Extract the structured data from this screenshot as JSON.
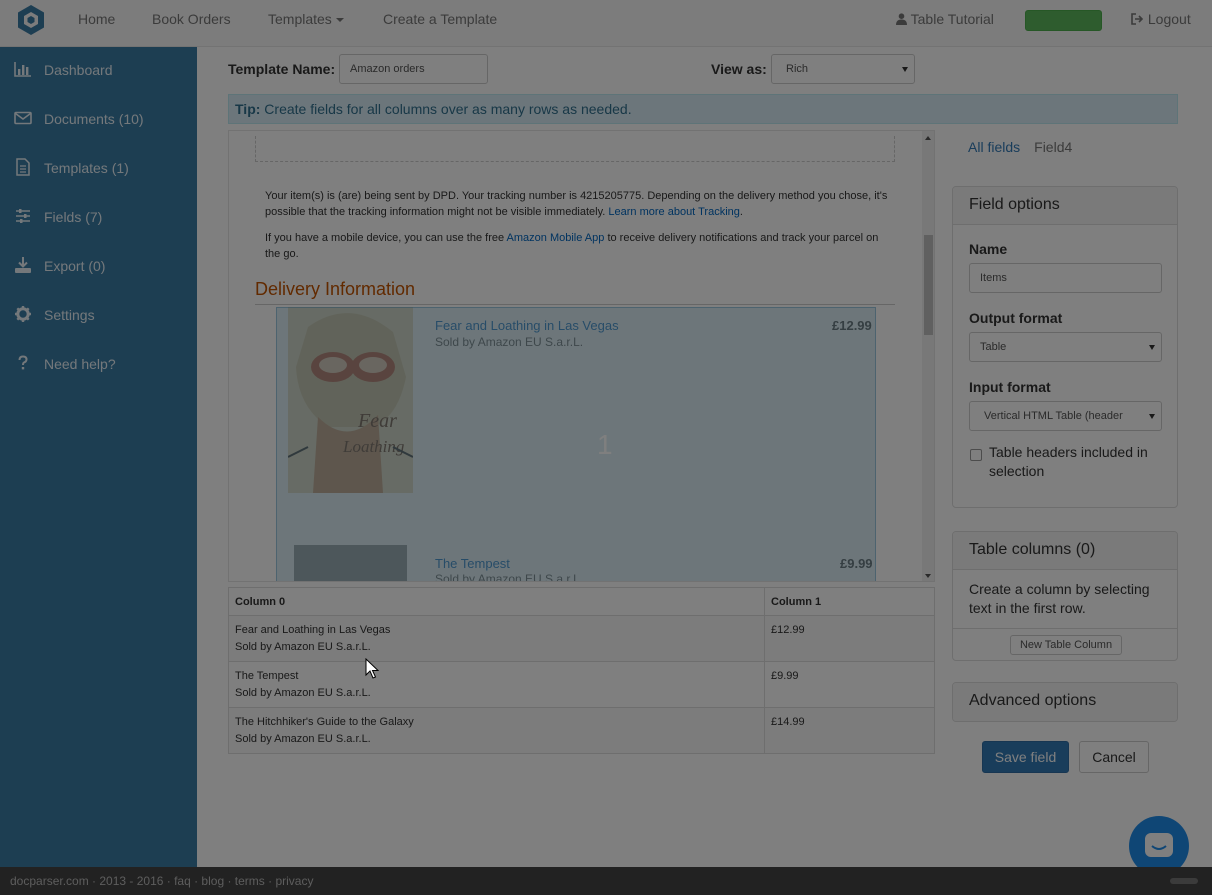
{
  "nav": {
    "links": [
      "Home",
      "Book Orders",
      "Templates",
      "Create a Template"
    ],
    "user": "Table Tutorial",
    "logout": "Logout",
    "badge_color": "#5cb85c"
  },
  "sidebar": {
    "bg_color": "#3a7ca5",
    "items": [
      {
        "label": "Dashboard",
        "icon": "bar-chart-icon"
      },
      {
        "label": "Documents (10)",
        "icon": "envelope-icon"
      },
      {
        "label": "Templates (1)",
        "icon": "file-icon"
      },
      {
        "label": "Fields (7)",
        "icon": "sliders-icon"
      },
      {
        "label": "Export (0)",
        "icon": "download-icon"
      },
      {
        "label": "Settings",
        "icon": "gear-icon"
      },
      {
        "label": "Need help?",
        "icon": "question-icon"
      }
    ]
  },
  "template": {
    "name_label": "Template Name:",
    "name_value": "Amazon orders",
    "viewas_label": "View as:",
    "viewas_value": "Rich"
  },
  "tip": {
    "prefix": "Tip:",
    "text": " Create fields for all columns over as many rows as needed."
  },
  "document": {
    "para1_a": "Your item(s) is (are) being sent by DPD. Your tracking number is 4215205775. Depending on the delivery method you chose, it's possible that the tracking information might not be visible immediately. ",
    "para1_link": "Learn more about Tracking",
    "para1_b": ".",
    "para2_a": "If you have a mobile device, you can use the free ",
    "para2_link": "Amazon Mobile App",
    "para2_b": " to receive delivery notifications and track your parcel on the go.",
    "heading": "Delivery Information",
    "selection_number": "1",
    "items": [
      {
        "title": "Fear and Loathing in Las Vegas",
        "seller": "Sold by Amazon EU S.a.r.L.",
        "price": "£12.99"
      },
      {
        "title": "The Tempest",
        "seller": "Sold by Amazon EU S.a.r.L.",
        "price": "£9.99"
      }
    ],
    "link_color": "#0066c0",
    "heading_color": "#c45500"
  },
  "results": {
    "headers": [
      "Column 0",
      "Column 1"
    ],
    "rows": [
      {
        "title": "Fear and Loathing in Las Vegas",
        "seller": "Sold by Amazon EU S.a.r.L.",
        "price": "£12.99"
      },
      {
        "title": "The Tempest",
        "seller": "Sold by Amazon EU S.a.r.L.",
        "price": "£9.99"
      },
      {
        "title": "The Hitchhiker's Guide to the Galaxy",
        "seller": "Sold by Amazon EU S.a.r.L.",
        "price": "£14.99"
      }
    ]
  },
  "panel": {
    "tabs": [
      "All fields",
      "Field4"
    ],
    "field_options": {
      "title": "Field options",
      "name_label": "Name",
      "name_value": "Items",
      "output_label": "Output format",
      "output_value": "Table",
      "input_label": "Input format",
      "input_value": "Vertical HTML Table (header",
      "checkbox_label": "Table headers included in selection"
    },
    "table_columns": {
      "title": "Table columns (0)",
      "text": "Create a column by selecting text in the first row.",
      "button": "New Table Column"
    },
    "advanced": {
      "title": "Advanced options"
    },
    "save": "Save field",
    "cancel": "Cancel",
    "primary_color": "#337ab7"
  },
  "footer": {
    "text": "docparser.com · 2013 - 2016 · faq · blog · terms · privacy"
  }
}
